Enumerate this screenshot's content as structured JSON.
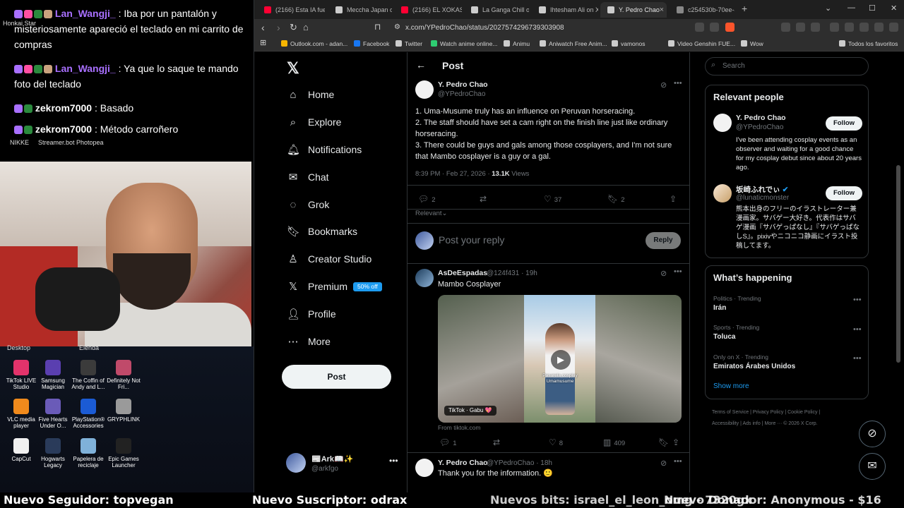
{
  "overlay": {
    "chat": [
      {
        "user": "Lan_Wangji_",
        "user_color": "#a970ff",
        "message": "Iba por un pantalón y misteriosamente apareció el teclado en mi carrito de compras"
      },
      {
        "user": "Lan_Wangji_",
        "user_color": "#a970ff",
        "message": "Ya que lo saque te mando foto del teclado"
      },
      {
        "user": "zekrom7000",
        "user_color": "#ffffff",
        "message": "Basado"
      },
      {
        "user": "zekrom7000",
        "user_color": "#ffffff",
        "message": "Método carroñero"
      }
    ],
    "floating_labels": [
      "Honkai Star",
      "NIKKE",
      "Streamer.bot",
      "Photopea",
      "Desktop",
      "Elenda"
    ],
    "desktop_icons": [
      {
        "label": "TikTok LIVE Studio",
        "color": "#e3336b"
      },
      {
        "label": "Samsung Magician",
        "color": "#5a3fb0"
      },
      {
        "label": "The Coffin of Andy and L...",
        "color": "#3b3b3b"
      },
      {
        "label": "Definitely Not Fri...",
        "color": "#c04a6a"
      },
      {
        "label": "VLC media player",
        "color": "#f08a1c"
      },
      {
        "label": "Five Hearts Under O...",
        "color": "#6a5bb8"
      },
      {
        "label": "PlayStation® Accessories",
        "color": "#1b5bd4"
      },
      {
        "label": "GRYPHLINK",
        "color": "#9a9a9a"
      },
      {
        "label": "CapCut",
        "color": "#f0f0f0"
      },
      {
        "label": "Hogwarts Legacy",
        "color": "#2a3b5a"
      },
      {
        "label": "Papelera de reciclaje",
        "color": "#7fb1d9"
      },
      {
        "label": "Epic Games Launcher",
        "color": "#222222"
      }
    ]
  },
  "ticker": {
    "items": [
      "Nuevo Seguidor: topvegan",
      "Nuevo Suscriptor: odrax",
      "Nuevos bits: israel_el_leon_omg - 7320gx",
      "Nuevo Donador: Anonymous - $16"
    ]
  },
  "browser": {
    "tabs": [
      {
        "label": "(2166) Esta IA fue",
        "favicon": "#ff0033",
        "active": false
      },
      {
        "label": "Meccha Japan on",
        "favicon": "#cccccc",
        "active": false
      },
      {
        "label": "(2166) EL XOKAS",
        "favicon": "#ff0033",
        "active": false
      },
      {
        "label": "La Ganga Chill on",
        "favicon": "#cccccc",
        "active": false
      },
      {
        "label": "Ihtesham Ali on X",
        "favicon": "#cccccc",
        "active": false
      },
      {
        "label": "Y. Pedro Chao",
        "favicon": "#cccccc",
        "active": true
      },
      {
        "label": "c254530b-70ee-4",
        "favicon": "#888888",
        "active": false
      }
    ],
    "tab_close": "×",
    "new_tab": "+",
    "window_controls": [
      "⌄",
      "—",
      "☐",
      "✕"
    ],
    "url": "x.com/YPedroChao/status/2027574296739303908",
    "bookmarks": [
      {
        "label": "Outlook.com - adan...",
        "color": "#f7b500"
      },
      {
        "label": "Facebook",
        "color": "#1877f2"
      },
      {
        "label": "Twitter",
        "color": "#cccccc"
      },
      {
        "label": "Watch anime online...",
        "color": "#2ecc71"
      },
      {
        "label": "Animu",
        "color": "#cccccc"
      },
      {
        "label": "Aniwatch Free Anim...",
        "color": "#cccccc"
      },
      {
        "label": "vamonos",
        "color": "#cccccc"
      },
      {
        "label": "Video Genshin FUE...",
        "color": "#cccccc"
      },
      {
        "label": "Wow",
        "color": "#cccccc"
      },
      {
        "label": "Todos los favoritos",
        "color": "#cccccc"
      }
    ]
  },
  "x": {
    "nav": {
      "logo": "𝕏",
      "items": [
        {
          "label": "Home",
          "icon": "home-icon",
          "glyph": "⌂"
        },
        {
          "label": "Explore",
          "icon": "search-icon",
          "glyph": "⌕"
        },
        {
          "label": "Notifications",
          "icon": "bell-icon",
          "glyph": "🔔︎"
        },
        {
          "label": "Chat",
          "icon": "mail-icon",
          "glyph": "✉"
        },
        {
          "label": "Grok",
          "icon": "grok-icon",
          "glyph": "◌"
        },
        {
          "label": "Bookmarks",
          "icon": "bookmark-icon",
          "glyph": "🔖︎"
        },
        {
          "label": "Creator Studio",
          "icon": "creator-studio-icon",
          "glyph": "♙"
        },
        {
          "label": "Premium",
          "icon": "x-logo-icon",
          "glyph": "𝕏",
          "badge": "50% off"
        },
        {
          "label": "Profile",
          "icon": "person-icon",
          "glyph": "👤︎"
        },
        {
          "label": "More",
          "icon": "more-circle-icon",
          "glyph": "⋯"
        }
      ],
      "post_button": "Post",
      "account": {
        "name": "📰Ark📖✨",
        "handle": "@arkfgo"
      }
    },
    "main": {
      "title": "Post",
      "tweet": {
        "name": "Y. Pedro Chao",
        "handle": "@YPedroChao",
        "lines": [
          "1. Uma-Musume truly has an influence on Peruvan horseracing.",
          "2. The staff should have set a cam right on the finish line just like ordinary horseracing.",
          "3. There could be guys and gals among those cosplayers, and I'm not sure that Mambo cosplayer is a guy or a gal."
        ],
        "time": "8:39 PM · Feb 27, 2026 ·",
        "views_count": "13.1K",
        "views_label": "Views",
        "replies": "2",
        "reposts": "",
        "likes": "37",
        "bookmarks": "2"
      },
      "sort_label": "Relevant⌄",
      "reply_placeholder": "Post your reply",
      "reply_button": "Reply",
      "replies": [
        {
          "name": "AsDeEspadas",
          "handle": "@124f431 · 19h",
          "text": "Mambo Cosplayer",
          "media_caption": "Pasarela cosplay Umamusume",
          "media_tag": "TikTok · Gabu 💖",
          "from": "From tiktok.com",
          "stats": {
            "replies": "1",
            "reposts": "",
            "likes": "8",
            "views": "409"
          }
        },
        {
          "name": "Y. Pedro Chao",
          "handle": "@YPedroChao · 18h",
          "text": "Thank you for the information. 🙂"
        }
      ]
    },
    "right": {
      "search_placeholder": "Search",
      "relevant_title": "Relevant people",
      "people": [
        {
          "name": "Y. Pedro Chao",
          "handle": "@YPedroChao",
          "bio": "I've been attending cosplay events as an observer and waiting for a good chance for my cosplay debut since about 20 years ago.",
          "follow": "Follow"
        },
        {
          "name": "坂崎ふれでぃ",
          "handle": "@lunaticmonster",
          "bio": "熊本出身のフリーのイラストレーター兼漫画家。サバゲー大好き。代表作はサバゲ漫画『サバゲっぱなし』『サバゲっぱなしS』。pixivやニコニコ静画にイラスト投稿してます。",
          "follow": "Follow"
        }
      ],
      "happening_title": "What’s happening",
      "trends": [
        {
          "category": "Politics · Trending",
          "name": "Irán"
        },
        {
          "category": "Sports · Trending",
          "name": "Toluca"
        },
        {
          "category": "Only on X · Trending",
          "name": "Emiratos Árabes Unidos"
        }
      ],
      "show_more": "Show more",
      "footer_line1": "Terms of Service  |  Privacy Policy  |  Cookie Policy  |",
      "footer_line2": "Accessibility  |  Ads info  |  More ···  © 2026 X Corp."
    }
  }
}
